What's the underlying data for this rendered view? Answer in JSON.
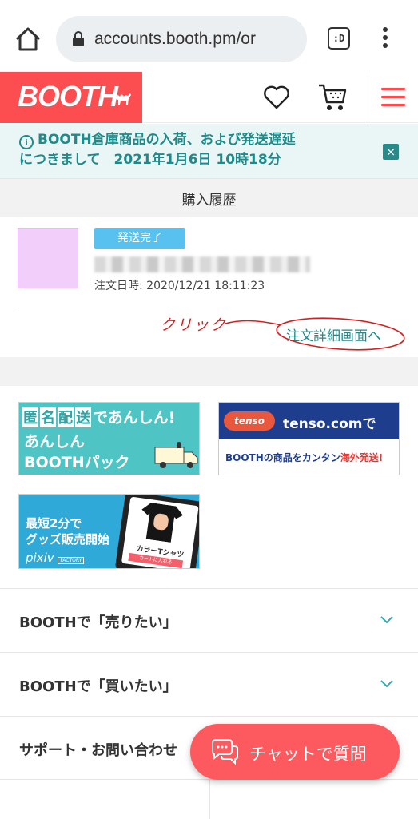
{
  "browser": {
    "url": "accounts.booth.pm/or",
    "tabs_label": ":D"
  },
  "header": {
    "logo": "BOOTH"
  },
  "notice": {
    "line1": "BOOTH倉庫商品の入荷、および発送遅延",
    "line2": "につきまして　2021年1月6日 10時18分",
    "close": "×"
  },
  "page": {
    "title": "購入履歴"
  },
  "order": {
    "status": "発送完了",
    "date": "注文日時: 2020/12/21 18:11:23",
    "detail_link": "注文詳細画面へ"
  },
  "annotation": {
    "text": "クリック"
  },
  "banners": {
    "anon": {
      "boxes": [
        "匿",
        "名",
        "配",
        "送"
      ],
      "tail": "であんしん!",
      "line1": "あんしん",
      "line2": "BOOTHパック"
    },
    "tenso": {
      "logo": "tenso",
      "title": "tenso.comで",
      "sub_a": "BOOTHの商品をカンタン",
      "sub_b": "海外発送!"
    },
    "pixiv": {
      "line1": "最短2分で",
      "line2": "グッズ販売開始",
      "logo": "pixiv",
      "factory": "FACTORY",
      "product": "カラーTシャツ",
      "cart": "カートに入れる"
    }
  },
  "accordions": [
    {
      "label": "BOOTHで「売りたい」"
    },
    {
      "label": "BOOTHで「買いたい」"
    },
    {
      "label": "サポート・お問い合わせ"
    }
  ],
  "chat": {
    "label": "チャットで質問"
  },
  "colors": {
    "brand": "#fc4d50",
    "teal": "#1f8a8a",
    "badge": "#58c1f0"
  }
}
